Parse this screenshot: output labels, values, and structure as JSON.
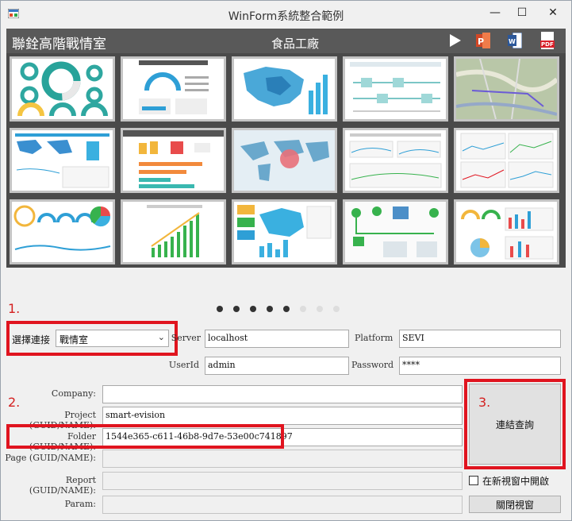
{
  "window": {
    "title": "WinForm系統整合範例",
    "minimize": "—",
    "maximize": "☐",
    "close": "✕"
  },
  "banner": {
    "title": "聯銓高階戰情室",
    "center_title": "食品工廠",
    "icons": [
      "play-icon",
      "powerpoint-icon",
      "word-icon",
      "pdf-icon"
    ],
    "ppt_text": "P",
    "word_text": "W",
    "pdf_text": "PDF"
  },
  "gallery": {
    "thumbnails": [
      "dashboard-donuts",
      "dashboard-gauge",
      "dashboard-china-map",
      "dashboard-flow",
      "dashboard-city-map",
      "dashboard-world-map",
      "dashboard-bar-report",
      "dashboard-world-bubble",
      "dashboard-tables",
      "dashboard-multi-line",
      "dashboard-gauges",
      "dashboard-growth-bars",
      "dashboard-china-heat",
      "dashboard-factory",
      "dashboard-kpi-mix"
    ]
  },
  "pager": {
    "total": 7,
    "active": 5
  },
  "steps": {
    "one": "1.",
    "two": "2.",
    "three": "3."
  },
  "form": {
    "select_label": "選擇連接",
    "select_value": "戰情室",
    "server_label": "Server",
    "server_value": "localhost",
    "platform_label": "Platform",
    "platform_value": "SEVI",
    "userid_label": "UserId",
    "userid_value": "admin",
    "password_label": "Password",
    "password_value": "****",
    "company_label": "Company:",
    "company_value": "",
    "project_label": "Project (GUID/NAME):",
    "project_value": "smart-evision",
    "folder_label": "Folder (GUID/NAME):",
    "folder_value": "1544e365-c611-46b8-9d7e-53e00c741897",
    "page_label": "Page (GUID/NAME):",
    "page_value": "",
    "report_label": "Report (GUID/NAME):",
    "report_value": "",
    "param_label": "Param:",
    "param_value": ""
  },
  "actions": {
    "connect_query": "連結查詢",
    "open_new_window": "在新視窗中開啟",
    "close_window": "關閉視窗"
  },
  "colors": {
    "banner": "#595959",
    "gallery_bg": "#4a4a4a",
    "highlight_red": "#e0141f",
    "accent_blue": "#2e9fd6"
  }
}
